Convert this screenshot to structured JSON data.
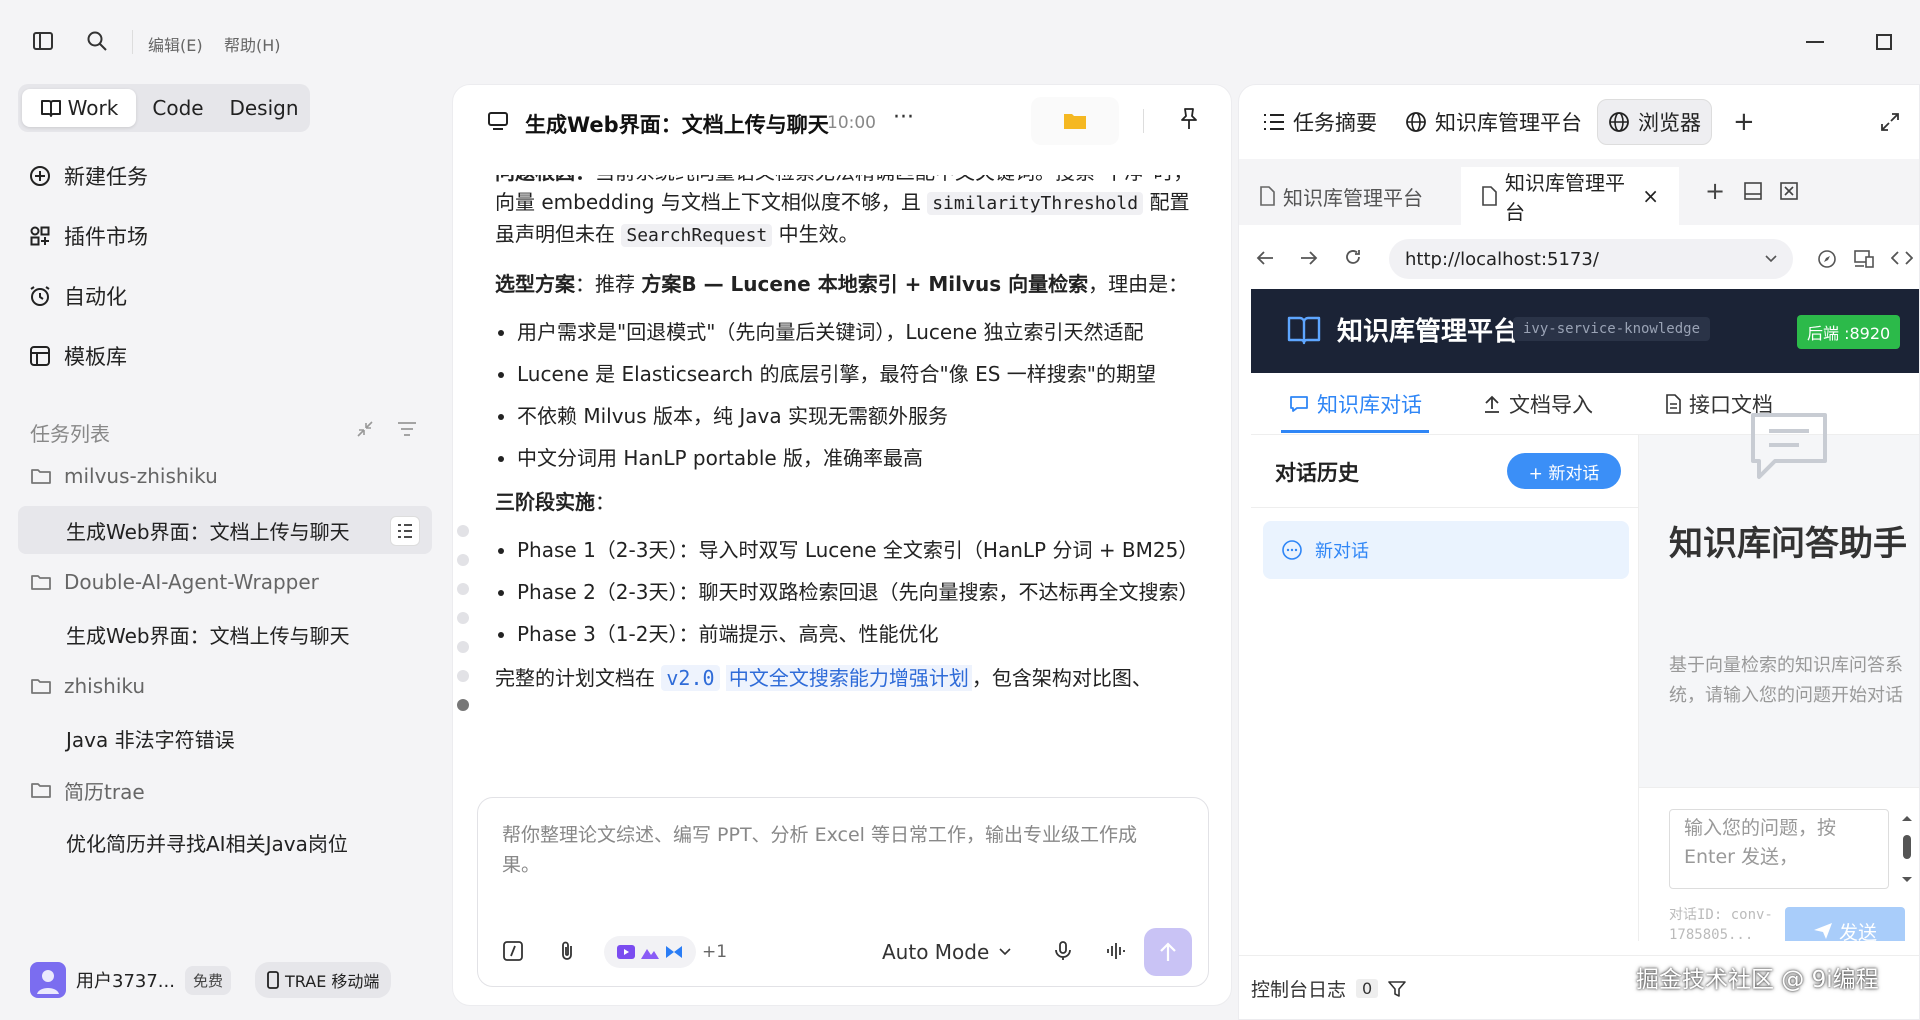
{
  "titlebar": {
    "menus": [
      "编辑(E)",
      "帮助(H)"
    ]
  },
  "sidebar": {
    "modes": [
      {
        "label": "Work",
        "active": true
      },
      {
        "label": "Code",
        "active": false
      },
      {
        "label": "Design",
        "active": false
      }
    ],
    "nav": [
      {
        "label": "新建任务",
        "icon": "plus-circle-icon"
      },
      {
        "label": "插件市场",
        "icon": "plugin-grid-icon"
      },
      {
        "label": "自动化",
        "icon": "alarm-clock-icon"
      },
      {
        "label": "模板库",
        "icon": "template-icon"
      }
    ],
    "task_list_title": "任务列表",
    "tree": [
      {
        "folder": "milvus-zhishiku",
        "tasks": [
          "生成Web界面：文档上传与聊天"
        ],
        "active_task": 0
      },
      {
        "folder": "Double-AI-Agent-Wrapper",
        "tasks": [
          "生成Web界面：文档上传与聊天"
        ]
      },
      {
        "folder": "zhishiku",
        "tasks": [
          "Java 非法字符错误"
        ]
      },
      {
        "folder": "简历trae",
        "tasks": [
          "优化简历并寻找AI相关Java岗位"
        ]
      }
    ],
    "user": {
      "name": "用户3737...",
      "plan": "免费",
      "mobile": "TRAE 移动端"
    }
  },
  "chat": {
    "title": "生成Web界面：文档上传与聊天",
    "time": "10:00",
    "more": "···",
    "body": {
      "p1_bold": "问题根因：",
      "p1_a": "当前系统纯向量语义检索无法精确匹配中文关键词。搜索\"干净\"时，向量 embedding 与文档上下文相似度不够，且 ",
      "p1_code1": "similarityThreshold",
      "p1_b": " 配置虽声明但未在 ",
      "p1_code2": "SearchRequest",
      "p1_c": " 中生效。",
      "p2_bold1": "选型方案",
      "p2_a": "：推荐 ",
      "p2_bold2": "方案B — Lucene 本地索引 + Milvus 向量检索",
      "p2_b": "，理由是：",
      "list1": [
        "用户需求是\"回退模式\"（先向量后关键词），Lucene 独立索引天然适配",
        "Lucene 是 Elasticsearch 的底层引擎，最符合\"像 ES 一样搜索\"的期望",
        "不依赖 Milvus 版本，纯 Java 实现无需额外服务",
        "中文分词用 HanLP portable 版，准确率最高"
      ],
      "p3_bold": "三阶段实施",
      "p3_colon": "：",
      "list2": [
        "Phase 1（2-3天）：导入时双写 Lucene 全文索引（HanLP 分词 + BM25）",
        "Phase 2（2-3天）：聊天时双路检索回退（先向量搜索，不达标再全文搜索）",
        "Phase 3（1-2天）：前端提示、高亮、性能优化"
      ],
      "p4_a": "完整的计划文档在 ",
      "p4_link_code": "v2.0",
      "p4_link_text": "中文全文搜索能力增强计划",
      "p4_b": "，包含架构对比图、"
    },
    "composer": {
      "placeholder": "帮你整理论文综述、编写 PPT、分析 Excel 等日常工作，输出专业级工作成果。",
      "plus_count": "+1",
      "mode": "Auto Mode"
    }
  },
  "right": {
    "tabs": [
      {
        "label": "任务摘要",
        "icon": "list-icon"
      },
      {
        "label": "知识库管理平台",
        "icon": "globe-icon"
      },
      {
        "label": "浏览器",
        "icon": "globe-icon",
        "active": true
      }
    ],
    "browser_tabs": [
      {
        "label": "知识库管理平台",
        "active": false
      },
      {
        "label": "知识库管理平台",
        "active": true,
        "close": "×"
      }
    ],
    "url": "http://localhost:5173/",
    "web": {
      "title": "知识库管理平台",
      "service_tag": "ivy-service-knowledge",
      "port": "后端 :8920",
      "nav": [
        {
          "label": "知识库对话",
          "active": true
        },
        {
          "label": "文档导入"
        },
        {
          "label": "接口文档"
        }
      ],
      "history_title": "对话历史",
      "new_chat_btn": "+ 新对话",
      "history_items": [
        "新对话"
      ],
      "assist_title": "知识库问答助手",
      "assist_desc": "基于向量检索的知识库问答系统，请输入您的问题开始对话",
      "input_placeholder": "输入您的问题，按 Enter 发送，",
      "conv_id_line1": "对话ID: conv-",
      "conv_id_line2": "1785805...",
      "send": "发送"
    },
    "console": {
      "label": "控制台日志",
      "count": "0"
    }
  },
  "watermark": "掘金技术社区 @ 9i编程",
  "colors": {
    "accent": "#2f86f6",
    "web_header": "#1b2336",
    "port_badge": "#2cba4a",
    "send_disabled": "#c9c3f5"
  }
}
